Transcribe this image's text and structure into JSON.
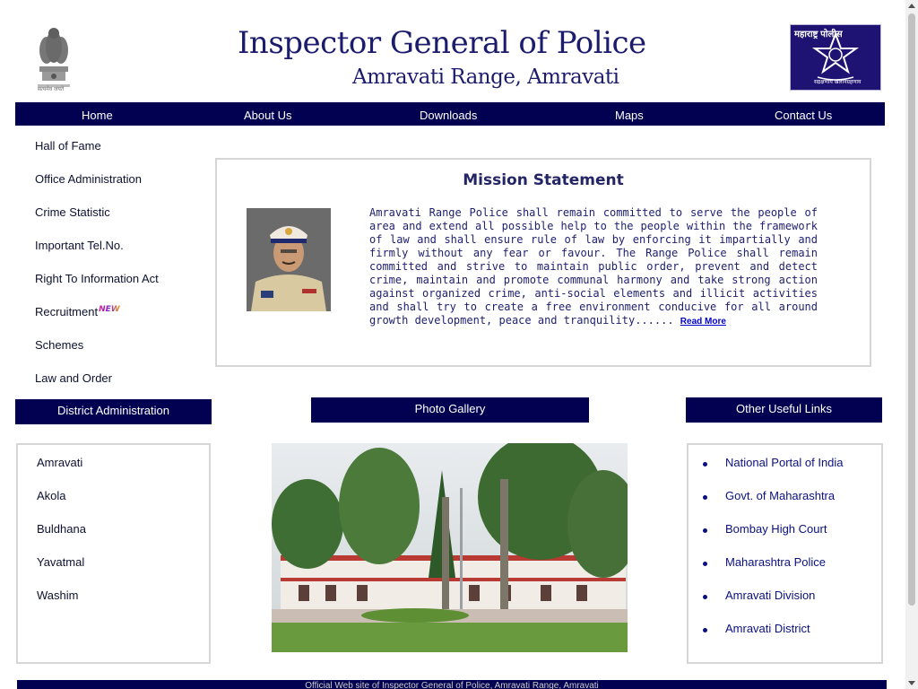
{
  "header": {
    "title": "Inspector General of Police",
    "subtitle": "Amravati Range, Amravati",
    "logo_text": "महाराष्ट्र पोलीस",
    "logo_motto": "सद्रक्षणाय खलनिग्रहणाय",
    "emblem_motto": "सत्यमेव जयते"
  },
  "nav": {
    "items": [
      "Home",
      "About Us",
      "Downloads",
      "Maps",
      "Contact Us"
    ]
  },
  "sidebar": {
    "items": [
      "Hall of Fame",
      "Office Administration",
      "Crime Statistic",
      "Important Tel.No.",
      "Right To Information Act",
      "Recruitment",
      "Schemes",
      "Law and Order"
    ],
    "new_badge": "NEW"
  },
  "mission": {
    "title": "Mission Statement",
    "text": "Amravati Range Police shall remain committed to serve the people of area and extend all possible help to the people within the framework of law and shall ensure rule of law by enforcing it impartially and firmly without any fear or favour. The Range Police shall remain committed and strive to maintain public order, prevent and detect crime, maintain and promote communal harmony and take strong action against organized crime, anti-social elements and illicit activities and shall try to create a free environment conducive for all around growth development, peace and tranquility......",
    "read_more": "Read More"
  },
  "district": {
    "heading": "District Administration",
    "items": [
      "Amravati",
      "Akola",
      "Buldhana",
      "Yavatmal",
      "Washim"
    ]
  },
  "gallery": {
    "heading": "Photo Gallery"
  },
  "links": {
    "heading": "Other Useful Links",
    "items": [
      "National Portal of India",
      "Govt. of Maharashtra",
      "Bombay High Court",
      "Maharashtra Police",
      "Amravati Division",
      "Amravati District"
    ]
  },
  "footer": {
    "text": "Official Web site of Inspector General of Police, Amravati Range, Amravati"
  },
  "colors": {
    "nav_bg": "#010051",
    "title": "#1c1c6e",
    "logo_bg": "#1e1272"
  }
}
